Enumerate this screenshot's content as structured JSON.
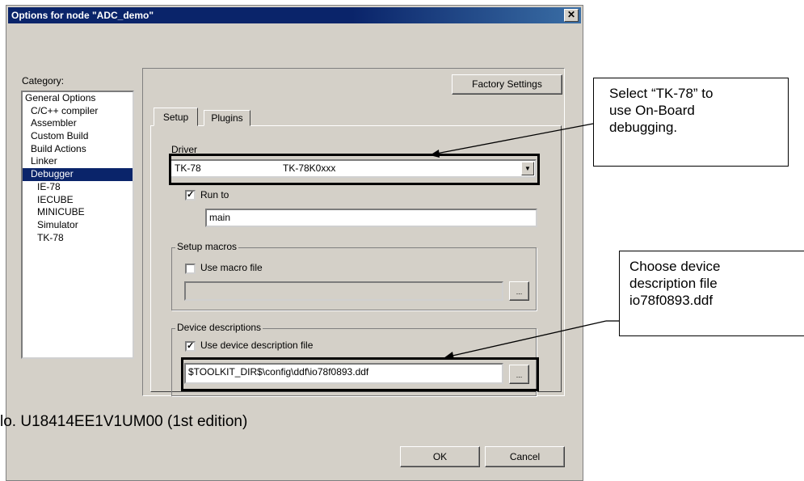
{
  "window": {
    "title": "Options for node \"ADC_demo\"",
    "close_glyph": "✕"
  },
  "category": {
    "label": "Category:",
    "items": [
      {
        "label": "General Options"
      },
      {
        "label": "C/C++ compiler"
      },
      {
        "label": "Assembler"
      },
      {
        "label": "Custom Build"
      },
      {
        "label": "Build Actions"
      },
      {
        "label": "Linker"
      },
      {
        "label": "Debugger"
      },
      {
        "label": "IE-78"
      },
      {
        "label": "IECUBE"
      },
      {
        "label": "MINICUBE"
      },
      {
        "label": "Simulator"
      },
      {
        "label": "TK-78"
      }
    ],
    "selected": "Debugger"
  },
  "buttons": {
    "factory_settings": "Factory Settings",
    "ok": "OK",
    "cancel": "Cancel",
    "browse": "..."
  },
  "tabs": [
    {
      "label": "Setup"
    },
    {
      "label": "Plugins"
    }
  ],
  "driver": {
    "label": "Driver",
    "value_name": "TK-78",
    "value_desc": "TK-78K0xxx"
  },
  "run_to": {
    "label": "Run to",
    "checked": true,
    "value": "main"
  },
  "setup_macros": {
    "legend": "Setup macros",
    "use_label": "Use macro file",
    "checked": false,
    "value": ""
  },
  "device_descriptions": {
    "legend": "Device descriptions",
    "use_label": "Use device description file",
    "checked": true,
    "value": "$TOOLKIT_DIR$\\config\\ddf\\io78f0893.ddf"
  },
  "callouts": {
    "driver_note": [
      "Select “TK-78” to",
      "use On-Board",
      "debugging."
    ],
    "ddf_note": [
      "Choose device",
      "description file",
      "io78f0893.ddf"
    ]
  },
  "doc_footer": "lo. U18414EE1V1UM00 (1st edition)",
  "colors": {
    "title_bar": "#0a246a",
    "selection": "#0a246a",
    "dialog_bg": "#d4d0c8"
  }
}
